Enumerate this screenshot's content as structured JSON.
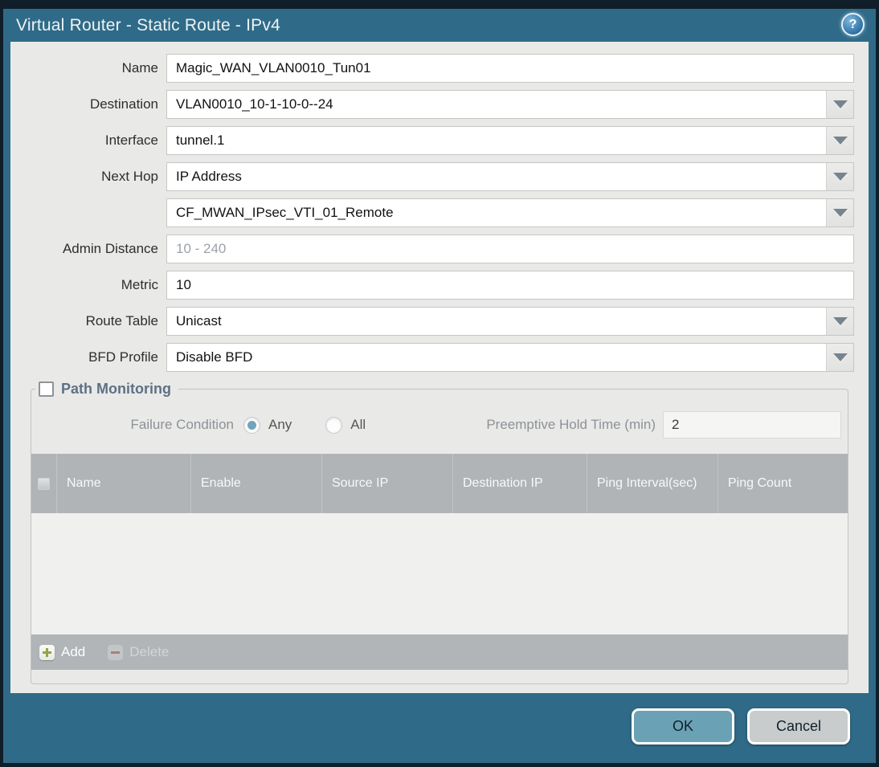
{
  "titlebar": {
    "title": "Virtual Router - Static Route - IPv4",
    "help_glyph": "?"
  },
  "form": {
    "name": {
      "label": "Name",
      "value": "Magic_WAN_VLAN0010_Tun01"
    },
    "destination": {
      "label": "Destination",
      "value": "VLAN0010_10-1-10-0--24"
    },
    "interface": {
      "label": "Interface",
      "value": "tunnel.1"
    },
    "next_hop": {
      "label": "Next Hop",
      "value": "IP Address"
    },
    "next_hop_address": {
      "value": "CF_MWAN_IPsec_VTI_01_Remote"
    },
    "admin_distance": {
      "label": "Admin Distance",
      "value": "",
      "placeholder": "10 - 240"
    },
    "metric": {
      "label": "Metric",
      "value": "10"
    },
    "route_table": {
      "label": "Route Table",
      "value": "Unicast"
    },
    "bfd_profile": {
      "label": "BFD Profile",
      "value": "Disable BFD"
    }
  },
  "path_monitoring": {
    "title": "Path Monitoring",
    "enabled": false,
    "failure_condition": {
      "label": "Failure Condition",
      "options": [
        {
          "label": "Any",
          "selected": true
        },
        {
          "label": "All",
          "selected": false
        }
      ]
    },
    "preemptive_hold_time": {
      "label": "Preemptive Hold Time (min)",
      "value": "2"
    },
    "table": {
      "columns": [
        "Name",
        "Enable",
        "Source IP",
        "Destination IP",
        "Ping Interval(sec)",
        "Ping Count"
      ],
      "rows": [],
      "add_label": "Add",
      "delete_label": "Delete"
    }
  },
  "footer": {
    "ok_label": "OK",
    "cancel_label": "Cancel"
  },
  "colors": {
    "frame_teal": "#2f6b88",
    "outer_border": "#101e29",
    "content_bg": "#e9e9e8",
    "table_header": "#b0b4b6",
    "ok_button": "#6ba1b5",
    "cancel_button": "#c9cccd",
    "add_plus_green": "#93a443",
    "delete_minus_red": "#aa7f77",
    "radio_selected": "#73a4b9",
    "pm_title_text": "#5d7183"
  }
}
